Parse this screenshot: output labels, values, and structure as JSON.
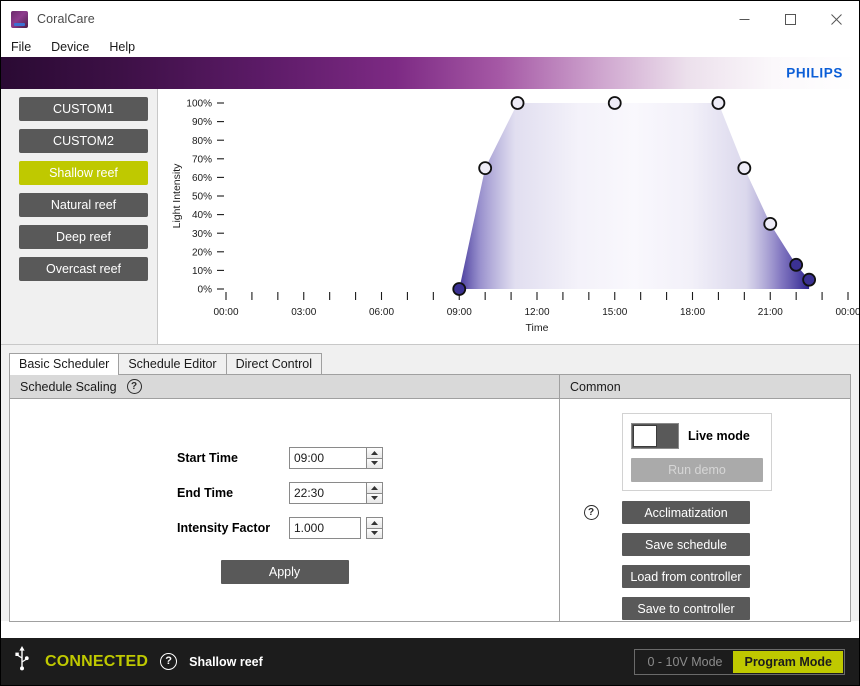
{
  "window": {
    "title": "CoralCare",
    "icon": "app-icon",
    "controls": {
      "minimize": "—",
      "maximize": "□",
      "close": "✕"
    }
  },
  "menu": {
    "items": [
      "File",
      "Device",
      "Help"
    ]
  },
  "brand": {
    "name": "PHILIPS",
    "color": "#0b5ed7"
  },
  "presets": {
    "items": [
      {
        "label": "CUSTOM1",
        "active": false
      },
      {
        "label": "CUSTOM2",
        "active": false
      },
      {
        "label": "Shallow reef",
        "active": true
      },
      {
        "label": "Natural reef",
        "active": false
      },
      {
        "label": "Deep reef",
        "active": false
      },
      {
        "label": "Overcast reef",
        "active": false
      }
    ],
    "active_color": "#bfc900",
    "inactive_color": "#595959"
  },
  "chart_data": {
    "type": "area",
    "title": "",
    "xlabel": "Time",
    "ylabel": "Light Intensity",
    "xlim": [
      "00:00",
      "24:00"
    ],
    "ylim": [
      0,
      100
    ],
    "grid": false,
    "legend": null,
    "ytick_labels": [
      "0%",
      "10%",
      "20%",
      "30%",
      "40%",
      "50%",
      "60%",
      "70%",
      "80%",
      "90%",
      "100%"
    ],
    "ytick_values": [
      0,
      10,
      20,
      30,
      40,
      50,
      60,
      70,
      80,
      90,
      100
    ],
    "xtick_labels": [
      "00:00",
      "03:00",
      "06:00",
      "09:00",
      "12:00",
      "15:00",
      "18:00",
      "21:00",
      "00:00"
    ],
    "xtick_hours": [
      0,
      3,
      6,
      9,
      12,
      15,
      18,
      21,
      24
    ],
    "minor_tick_interval_hours": 1,
    "series": [
      {
        "name": "Shallow reef",
        "x": [
          "09:00",
          "10:00",
          "11:15",
          "15:00",
          "19:00",
          "20:00",
          "21:00",
          "22:00",
          "22:30"
        ],
        "x_hours": [
          9,
          10,
          11.25,
          15,
          19,
          20,
          21,
          22,
          22.5
        ],
        "values": [
          0,
          65,
          100,
          100,
          100,
          65,
          35,
          13,
          5
        ],
        "fill": "lavender-gradient",
        "marker": "circle"
      }
    ]
  },
  "tabs": {
    "items": [
      {
        "label": "Basic Scheduler",
        "selected": true
      },
      {
        "label": "Schedule Editor",
        "selected": false
      },
      {
        "label": "Direct Control",
        "selected": false
      }
    ]
  },
  "schedule_scaling": {
    "title": "Schedule Scaling",
    "help_icon": "question-mark-icon",
    "fields": [
      {
        "label": "Start Time",
        "value": "09:00"
      },
      {
        "label": "End Time",
        "value": "22:30"
      },
      {
        "label": "Intensity Factor",
        "value": "1.000"
      }
    ],
    "apply_label": "Apply"
  },
  "common": {
    "title": "Common",
    "live_mode": {
      "label": "Live mode",
      "on": false
    },
    "run_demo": {
      "label": "Run demo",
      "enabled": false
    },
    "help_icon": "question-mark-icon",
    "buttons": [
      {
        "label": "Acclimatization"
      },
      {
        "label": "Save schedule"
      },
      {
        "label": "Load from controller"
      },
      {
        "label": "Save to controller"
      }
    ]
  },
  "statusbar": {
    "usb_icon": "usb-icon",
    "status": "CONNECTED",
    "status_color": "#bfc900",
    "help_icon": "question-mark-icon",
    "preset": "Shallow reef",
    "modes": [
      {
        "label": "0 - 10V Mode",
        "active": false
      },
      {
        "label": "Program Mode",
        "active": true
      }
    ]
  }
}
